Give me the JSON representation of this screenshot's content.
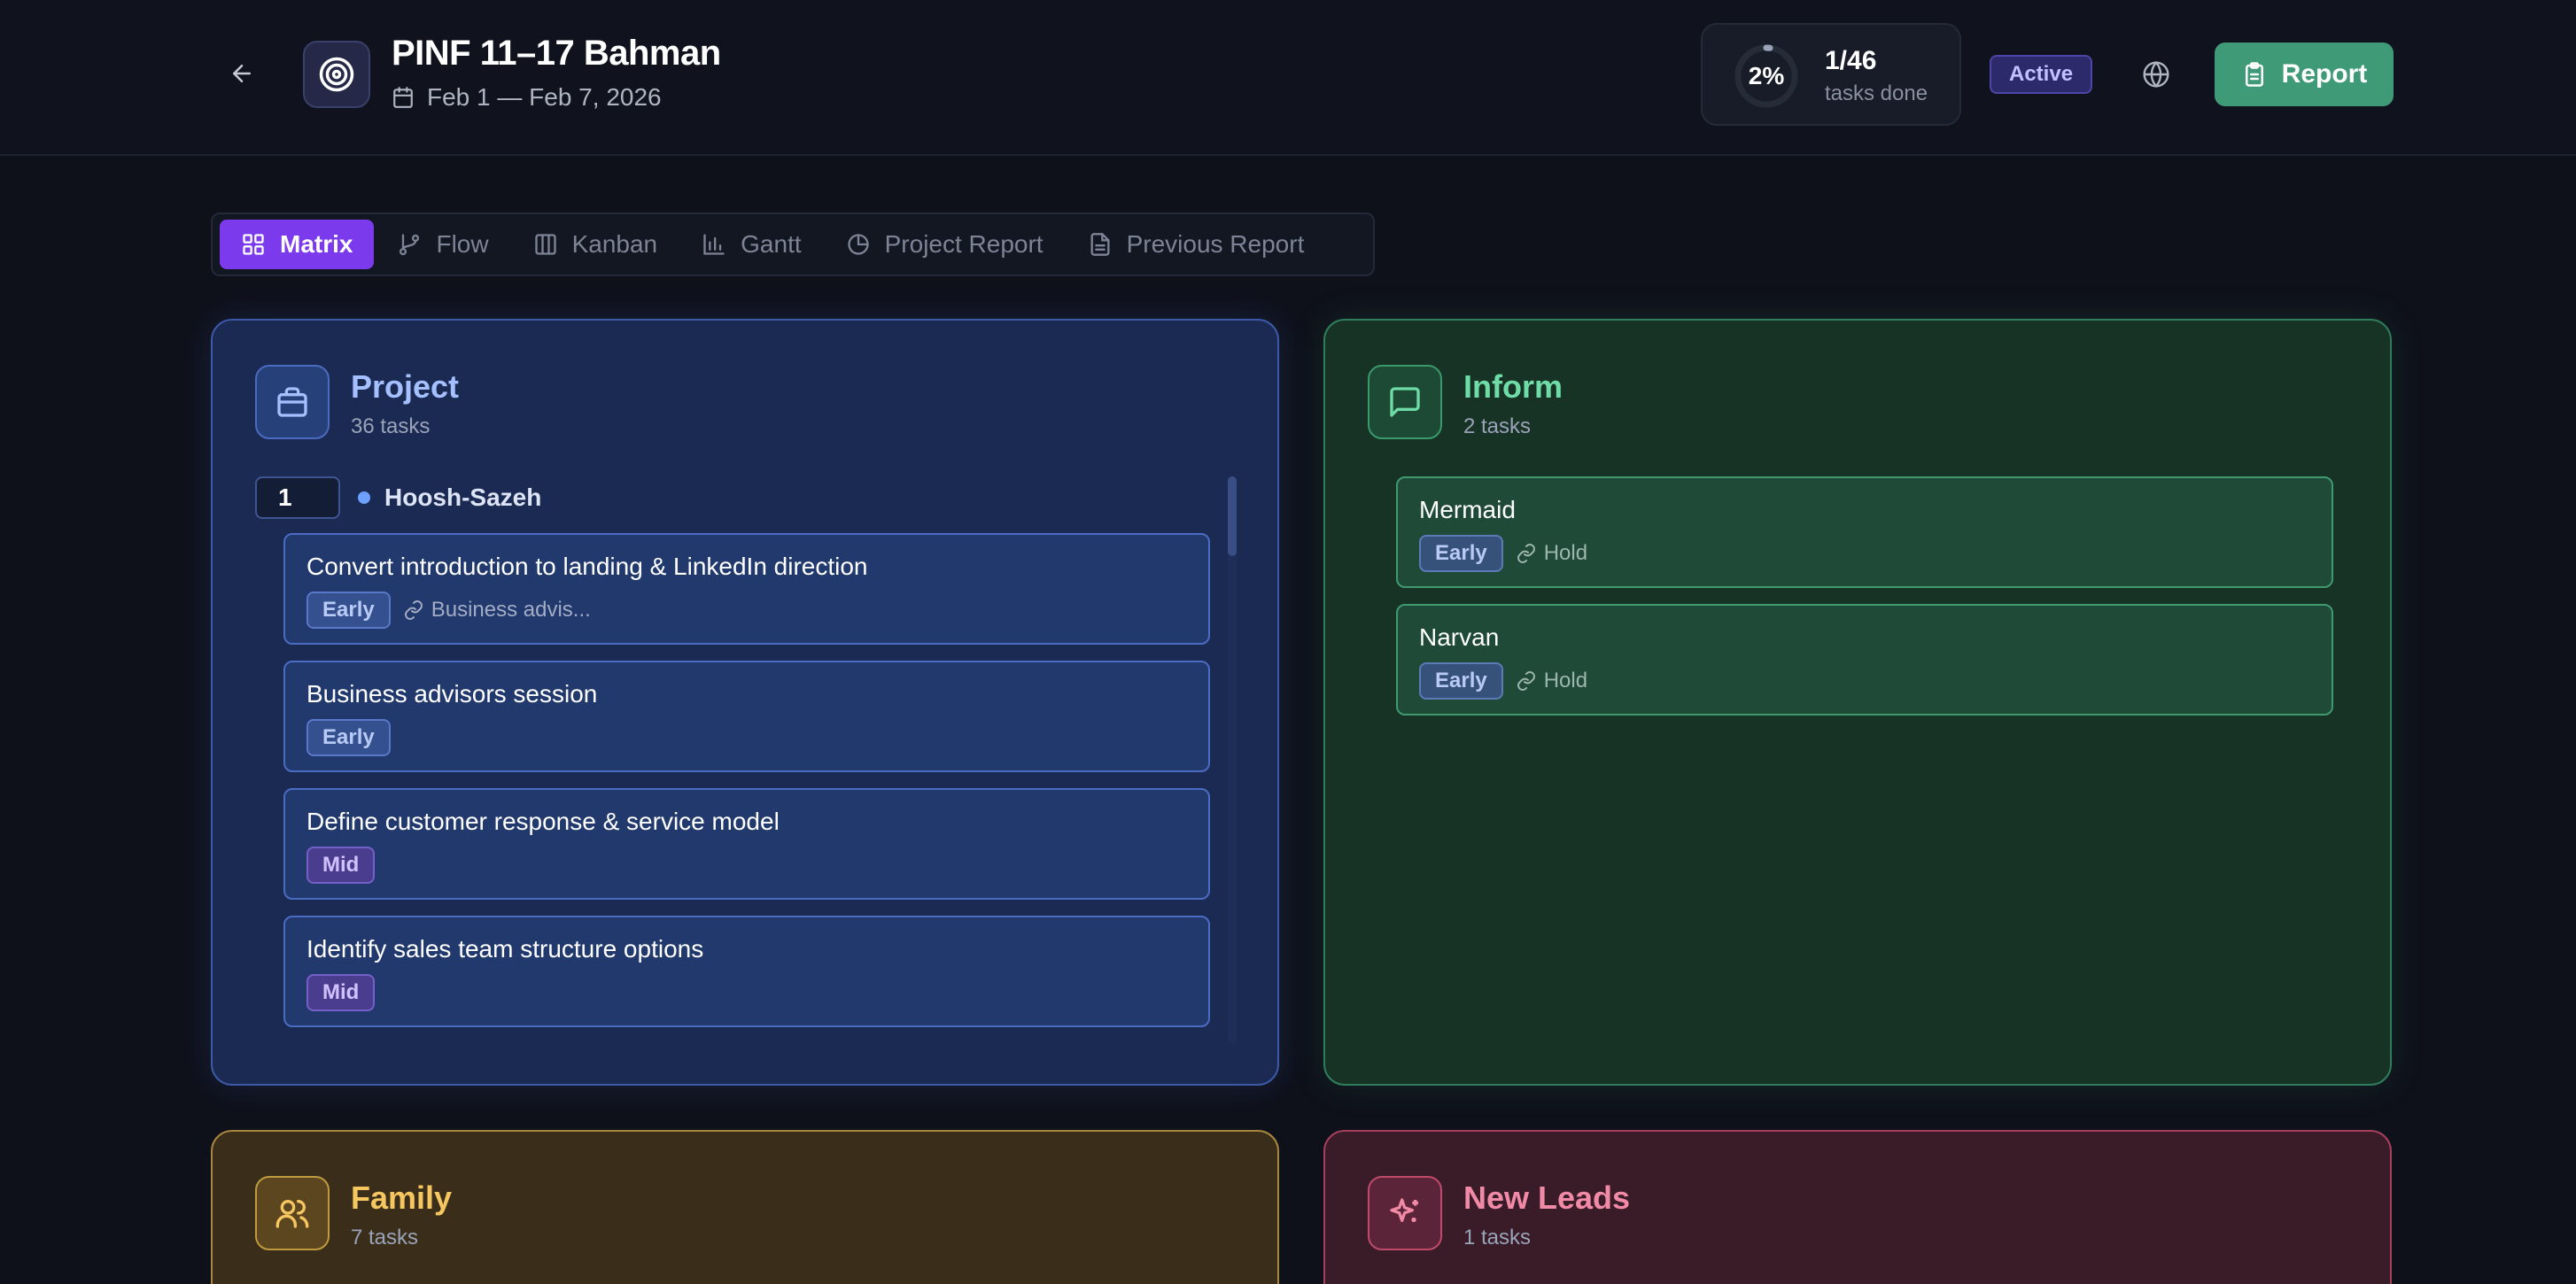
{
  "header": {
    "title": "PINF 11–17 Bahman",
    "date_range": "Feb 1 — Feb 7, 2026",
    "progress_percent_label": "2%",
    "progress_fraction": 0.02,
    "tasks_done_count": "1/46",
    "tasks_done_label": "tasks done",
    "status": "Active",
    "report_label": "Report"
  },
  "tabs": [
    {
      "label": "Matrix",
      "icon": "grid-icon",
      "active": true
    },
    {
      "label": "Flow",
      "icon": "git-branch-icon",
      "active": false
    },
    {
      "label": "Kanban",
      "icon": "columns-icon",
      "active": false
    },
    {
      "label": "Gantt",
      "icon": "bar-chart-icon",
      "active": false
    },
    {
      "label": "Project Report",
      "icon": "pie-chart-icon",
      "active": false
    },
    {
      "label": "Previous Report",
      "icon": "file-text-icon",
      "active": false
    }
  ],
  "quadrants": {
    "project": {
      "title": "Project",
      "count": "36 tasks",
      "icon": "briefcase-icon",
      "group": {
        "number": "1",
        "name": "Hoosh-Sazeh"
      },
      "tasks": [
        {
          "title": "Convert introduction to landing & LinkedIn direction",
          "tag": "Early",
          "dependency": "Business advis..."
        },
        {
          "title": "Business advisors session",
          "tag": "Early",
          "dependency": ""
        },
        {
          "title": "Define customer response & service model",
          "tag": "Mid",
          "dependency": ""
        },
        {
          "title": "Identify sales team structure options",
          "tag": "Mid",
          "dependency": ""
        }
      ]
    },
    "inform": {
      "title": "Inform",
      "count": "2 tasks",
      "icon": "message-square-icon",
      "tasks": [
        {
          "title": "Mermaid",
          "tag": "Early",
          "dependency": "Hold"
        },
        {
          "title": "Narvan",
          "tag": "Early",
          "dependency": "Hold"
        }
      ]
    },
    "family": {
      "title": "Family",
      "count": "7 tasks",
      "icon": "users-icon"
    },
    "leads": {
      "title": "New Leads",
      "count": "1 tasks",
      "icon": "sparkles-icon"
    }
  },
  "colors": {
    "accent": "#7c3aed",
    "report_button": "#3f9a77",
    "project": "#3d5aa8",
    "inform": "#2f7d5a",
    "family": "#a8863d",
    "leads": "#a53f5c"
  }
}
